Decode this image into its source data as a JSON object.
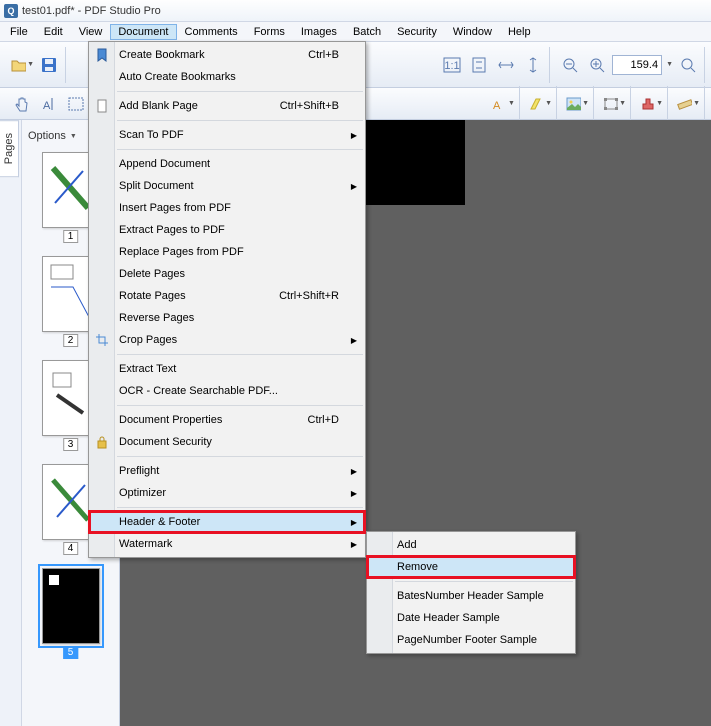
{
  "window": {
    "app_icon_letter": "Q",
    "title": "test01.pdf* - PDF Studio Pro"
  },
  "menubar": {
    "items": [
      "File",
      "Edit",
      "View",
      "Document",
      "Comments",
      "Forms",
      "Images",
      "Batch",
      "Security",
      "Window",
      "Help"
    ],
    "active_index": 3
  },
  "toolbar": {
    "zoom_value": "159.4"
  },
  "sidebar": {
    "tab_label": "Pages",
    "options_label": "Options"
  },
  "thumbnails": [
    {
      "page": "1",
      "selected": false
    },
    {
      "page": "2",
      "selected": false
    },
    {
      "page": "3",
      "selected": false
    },
    {
      "page": "4",
      "selected": false
    },
    {
      "page": "5",
      "selected": true
    }
  ],
  "document_menu": {
    "groups": [
      [
        {
          "label": "Create Bookmark",
          "shortcut": "Ctrl+B",
          "icon": "bookmark"
        },
        {
          "label": "Auto Create Bookmarks"
        }
      ],
      [
        {
          "label": "Add Blank Page",
          "shortcut": "Ctrl+Shift+B",
          "icon": "blank-page"
        }
      ],
      [
        {
          "label": "Scan To PDF",
          "submenu": true
        }
      ],
      [
        {
          "label": "Append Document"
        },
        {
          "label": "Split Document",
          "submenu": true
        },
        {
          "label": "Insert Pages from PDF"
        },
        {
          "label": "Extract Pages to PDF"
        },
        {
          "label": "Replace Pages from PDF"
        },
        {
          "label": "Delete Pages"
        },
        {
          "label": "Rotate Pages",
          "shortcut": "Ctrl+Shift+R"
        },
        {
          "label": "Reverse Pages"
        },
        {
          "label": "Crop Pages",
          "submenu": true,
          "icon": "crop"
        }
      ],
      [
        {
          "label": "Extract Text"
        },
        {
          "label": "OCR - Create Searchable PDF..."
        }
      ],
      [
        {
          "label": "Document Properties",
          "shortcut": "Ctrl+D"
        },
        {
          "label": "Document Security",
          "icon": "security"
        }
      ],
      [
        {
          "label": "Preflight",
          "submenu": true
        },
        {
          "label": "Optimizer",
          "submenu": true
        }
      ],
      [
        {
          "label": "Header & Footer",
          "submenu": true,
          "highlight": true,
          "hover": true
        },
        {
          "label": "Watermark",
          "submenu": true
        }
      ]
    ]
  },
  "submenu": {
    "groups": [
      [
        {
          "label": "Add"
        },
        {
          "label": "Remove",
          "highlight": true,
          "hover": true
        }
      ],
      [
        {
          "label": "BatesNumber Header Sample"
        },
        {
          "label": "Date Header Sample"
        },
        {
          "label": "PageNumber Footer Sample"
        }
      ]
    ]
  }
}
